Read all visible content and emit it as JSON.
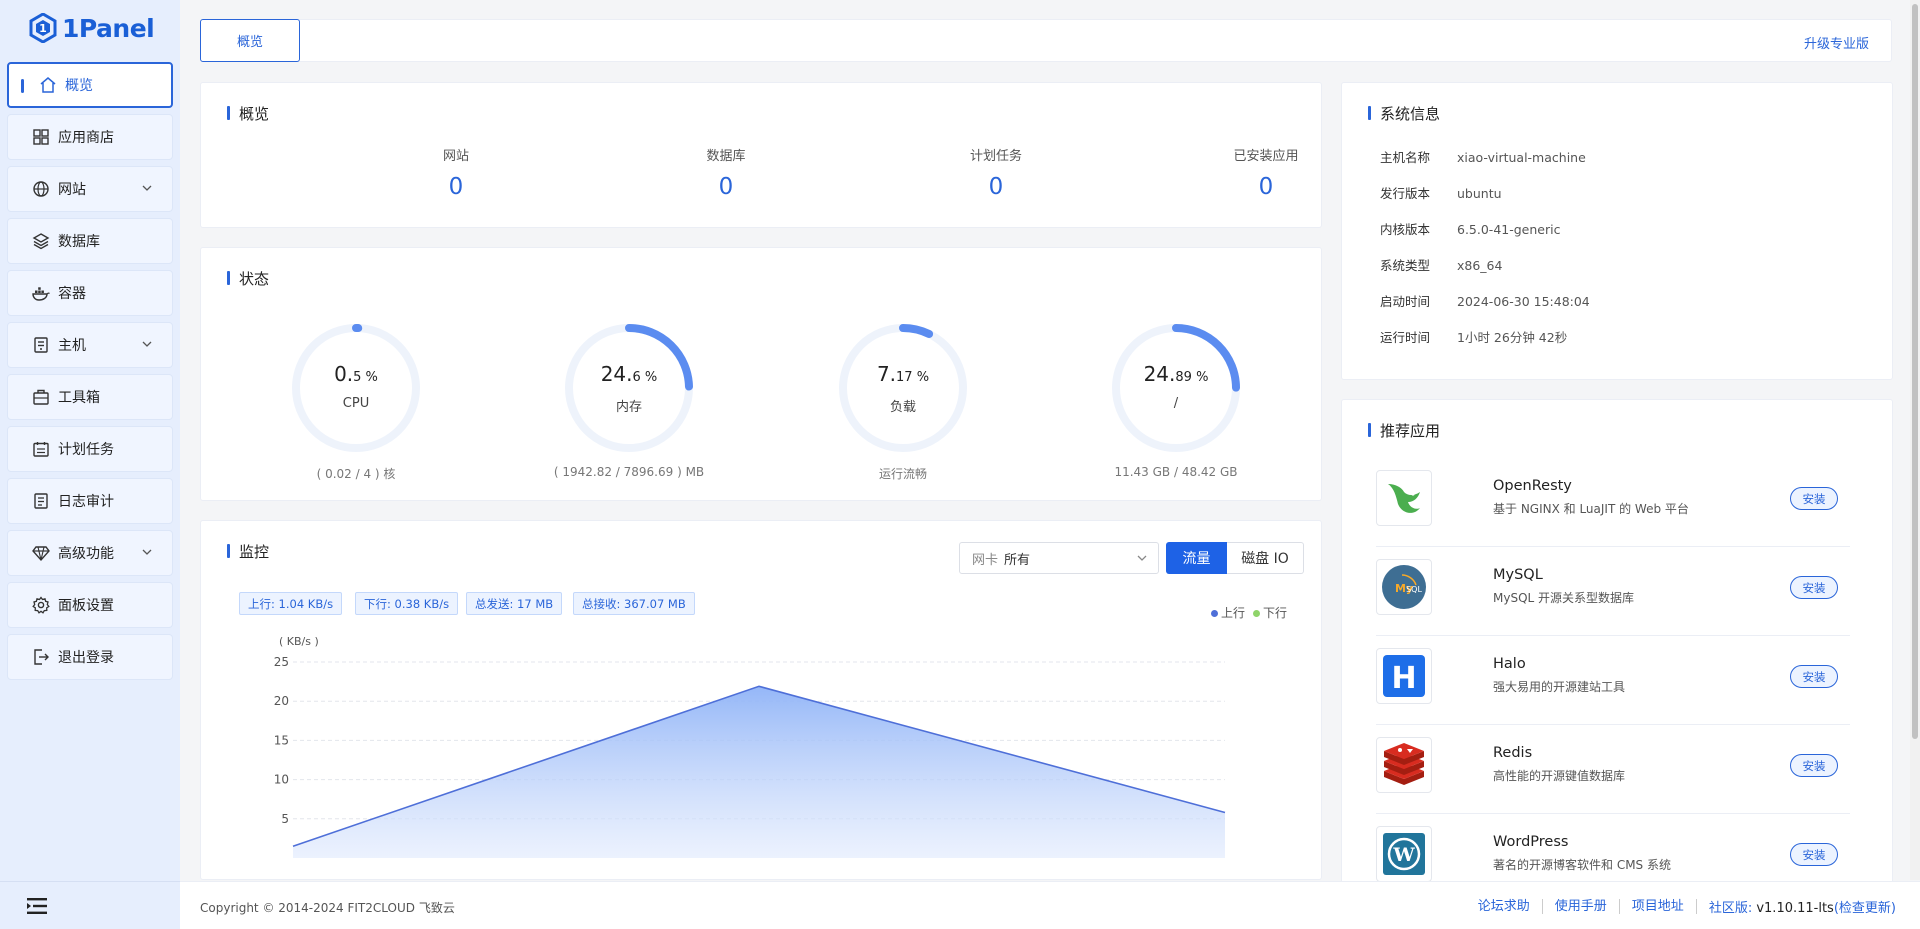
{
  "app": {
    "logo_text": "1Panel"
  },
  "sidebar": {
    "items": [
      {
        "label": "概览",
        "icon": "home-icon",
        "active": true
      },
      {
        "label": "应用商店",
        "icon": "grid-icon"
      },
      {
        "label": "网站",
        "icon": "globe-icon",
        "expandable": true
      },
      {
        "label": "数据库",
        "icon": "layers-icon"
      },
      {
        "label": "容器",
        "icon": "docker-icon"
      },
      {
        "label": "主机",
        "icon": "server-icon",
        "expandable": true
      },
      {
        "label": "工具箱",
        "icon": "toolbox-icon"
      },
      {
        "label": "计划任务",
        "icon": "calendar-icon"
      },
      {
        "label": "日志审计",
        "icon": "log-icon"
      },
      {
        "label": "高级功能",
        "icon": "diamond-icon",
        "expandable": true
      },
      {
        "label": "面板设置",
        "icon": "gear-icon"
      },
      {
        "label": "退出登录",
        "icon": "logout-icon"
      }
    ]
  },
  "topbar": {
    "tab_label": "概览",
    "upgrade_label": "升级专业版"
  },
  "overview": {
    "title": "概览",
    "stats": [
      {
        "label": "网站",
        "value": "0"
      },
      {
        "label": "数据库",
        "value": "0"
      },
      {
        "label": "计划任务",
        "value": "0"
      },
      {
        "label": "已安装应用",
        "value": "0"
      }
    ]
  },
  "status": {
    "title": "状态",
    "gauges": [
      {
        "int": "0.",
        "dec": "5 %",
        "name": "CPU",
        "foot": "( 0.02 / 4 ) 核",
        "percent": 0.5
      },
      {
        "int": "24.",
        "dec": "6 %",
        "name": "内存",
        "foot": "( 1942.82 / 7896.69 ) MB",
        "percent": 24.6
      },
      {
        "int": "7.",
        "dec": "17 %",
        "name": "负载",
        "foot": "运行流畅",
        "percent": 7.17
      },
      {
        "int": "24.",
        "dec": "89 %",
        "name": "/",
        "foot": "11.43 GB / 48.42 GB",
        "percent": 24.89
      }
    ]
  },
  "monitor": {
    "title": "监控",
    "nic_label": "网卡",
    "nic_value": "所有",
    "btn_traffic": "流量",
    "btn_disk": "磁盘 IO",
    "tags": [
      "上行: 1.04 KB/s",
      "下行: 0.38 KB/s",
      "总发送: 17 MB",
      "总接收: 367.07 MB"
    ],
    "legend_up": "上行",
    "legend_down": "下行",
    "colors": {
      "up": "#4e6fd8",
      "down": "#8fd46a"
    }
  },
  "chart_data": {
    "type": "area",
    "ylabel": "( KB/s )",
    "yticks": [
      25,
      20,
      15,
      10,
      5
    ],
    "ylim": [
      0,
      25
    ],
    "series": [
      {
        "name": "上行",
        "points": [
          [
            0,
            1.5
          ],
          [
            0.5,
            21.9
          ],
          [
            1.0,
            5.8
          ]
        ]
      }
    ]
  },
  "sysinfo": {
    "title": "系统信息",
    "rows": [
      {
        "k": "主机名称",
        "v": "xiao-virtual-machine"
      },
      {
        "k": "发行版本",
        "v": "ubuntu"
      },
      {
        "k": "内核版本",
        "v": "6.5.0-41-generic"
      },
      {
        "k": "系统类型",
        "v": "x86_64"
      },
      {
        "k": "启动时间",
        "v": "2024-06-30 15:48:04"
      },
      {
        "k": "运行时间",
        "v": "1小时 26分钟 42秒"
      }
    ]
  },
  "recommend": {
    "title": "推荐应用",
    "install_label": "安装",
    "apps": [
      {
        "name": "OpenResty",
        "desc": "基于 NGINX 和 LuaJIT 的 Web 平台",
        "icon": "openresty-icon"
      },
      {
        "name": "MySQL",
        "desc": "MySQL 开源关系型数据库",
        "icon": "mysql-icon"
      },
      {
        "name": "Halo",
        "desc": "强大易用的开源建站工具",
        "icon": "halo-icon"
      },
      {
        "name": "Redis",
        "desc": "高性能的开源键值数据库",
        "icon": "redis-icon"
      },
      {
        "name": "WordPress",
        "desc": "著名的开源博客软件和 CMS 系统",
        "icon": "wordpress-icon"
      }
    ]
  },
  "footer": {
    "copyright": "Copyright © 2014-2024 FIT2CLOUD 飞致云",
    "links": [
      "论坛求助",
      "使用手册",
      "项目地址"
    ],
    "edition": "社区版:",
    "version": "v1.10.11-lts",
    "check_update": "(检查更新)"
  }
}
